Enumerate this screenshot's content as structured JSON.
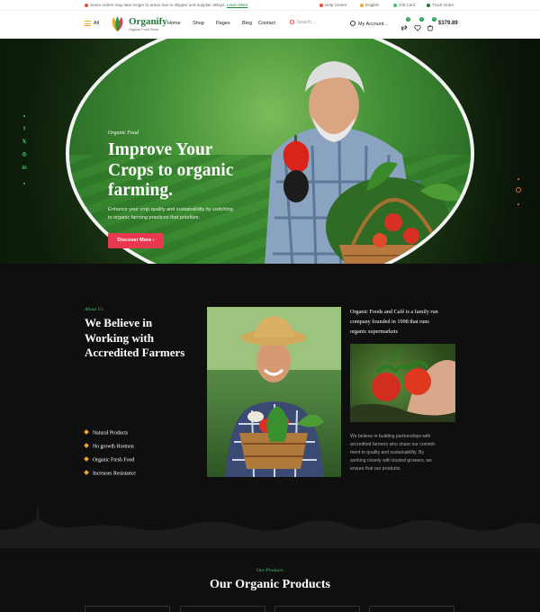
{
  "topbar": {
    "notice": "Some orders may take longer to arrive due to shipper and supplier delays.",
    "notice_link": "Learn More",
    "links": [
      "Help Center",
      "English",
      "Gift Card",
      "Track Order"
    ]
  },
  "header": {
    "all_label": "All",
    "logo_name": "Organify",
    "logo_tagline": "Organic Food Store",
    "nav": [
      "Home",
      "Shop",
      "Pages",
      "Blog",
      "Contact"
    ],
    "search_placeholder": "Search....",
    "account_label": "My Account",
    "cart_badge": "0",
    "wishlist_badge": "0",
    "compare_badge": "0",
    "cart_total": "$379.89"
  },
  "hero": {
    "script_label": "Organic Food",
    "title_lines": [
      "Improve Your",
      "Crops to organic",
      "farming."
    ],
    "description_lines": [
      "Enhance your crop quality and sustainability by switching",
      "to organic farming practices that prioritize."
    ],
    "button_label": "Discover More"
  },
  "social": {
    "icons": [
      "facebook-icon",
      "x-icon",
      "instagram-icon",
      "linkedin-icon"
    ],
    "glyphs": [
      "f",
      "𝕏",
      "◎",
      "in"
    ]
  },
  "about": {
    "script_label": "About Us",
    "title_lines": [
      "We Believe in",
      "Working with",
      "Accredited Farmers"
    ],
    "features": [
      "Natural Products",
      "No growth Hormon",
      "Organic Fresh Food",
      "Increases Resistance"
    ],
    "company_lines": [
      "Organic Foods and Café is a family run",
      "company founded in 1998 that runs",
      "organic supermarkets"
    ],
    "partner_lines": [
      "We believe in building partnerships with",
      "accredited farmers who share our commit-",
      "ment to quality and sustainability. By",
      "working closely with trusted growers, we",
      "ensure that our products."
    ]
  },
  "products": {
    "script_label": "Our Products",
    "title": "Our Organic Products"
  },
  "colors": {
    "brand_green": "#1e7a36",
    "accent_red": "#e8384f",
    "accent_orange": "#f5a623",
    "bright_green": "#3ec76a",
    "dark_bg": "#0f0f0f"
  }
}
